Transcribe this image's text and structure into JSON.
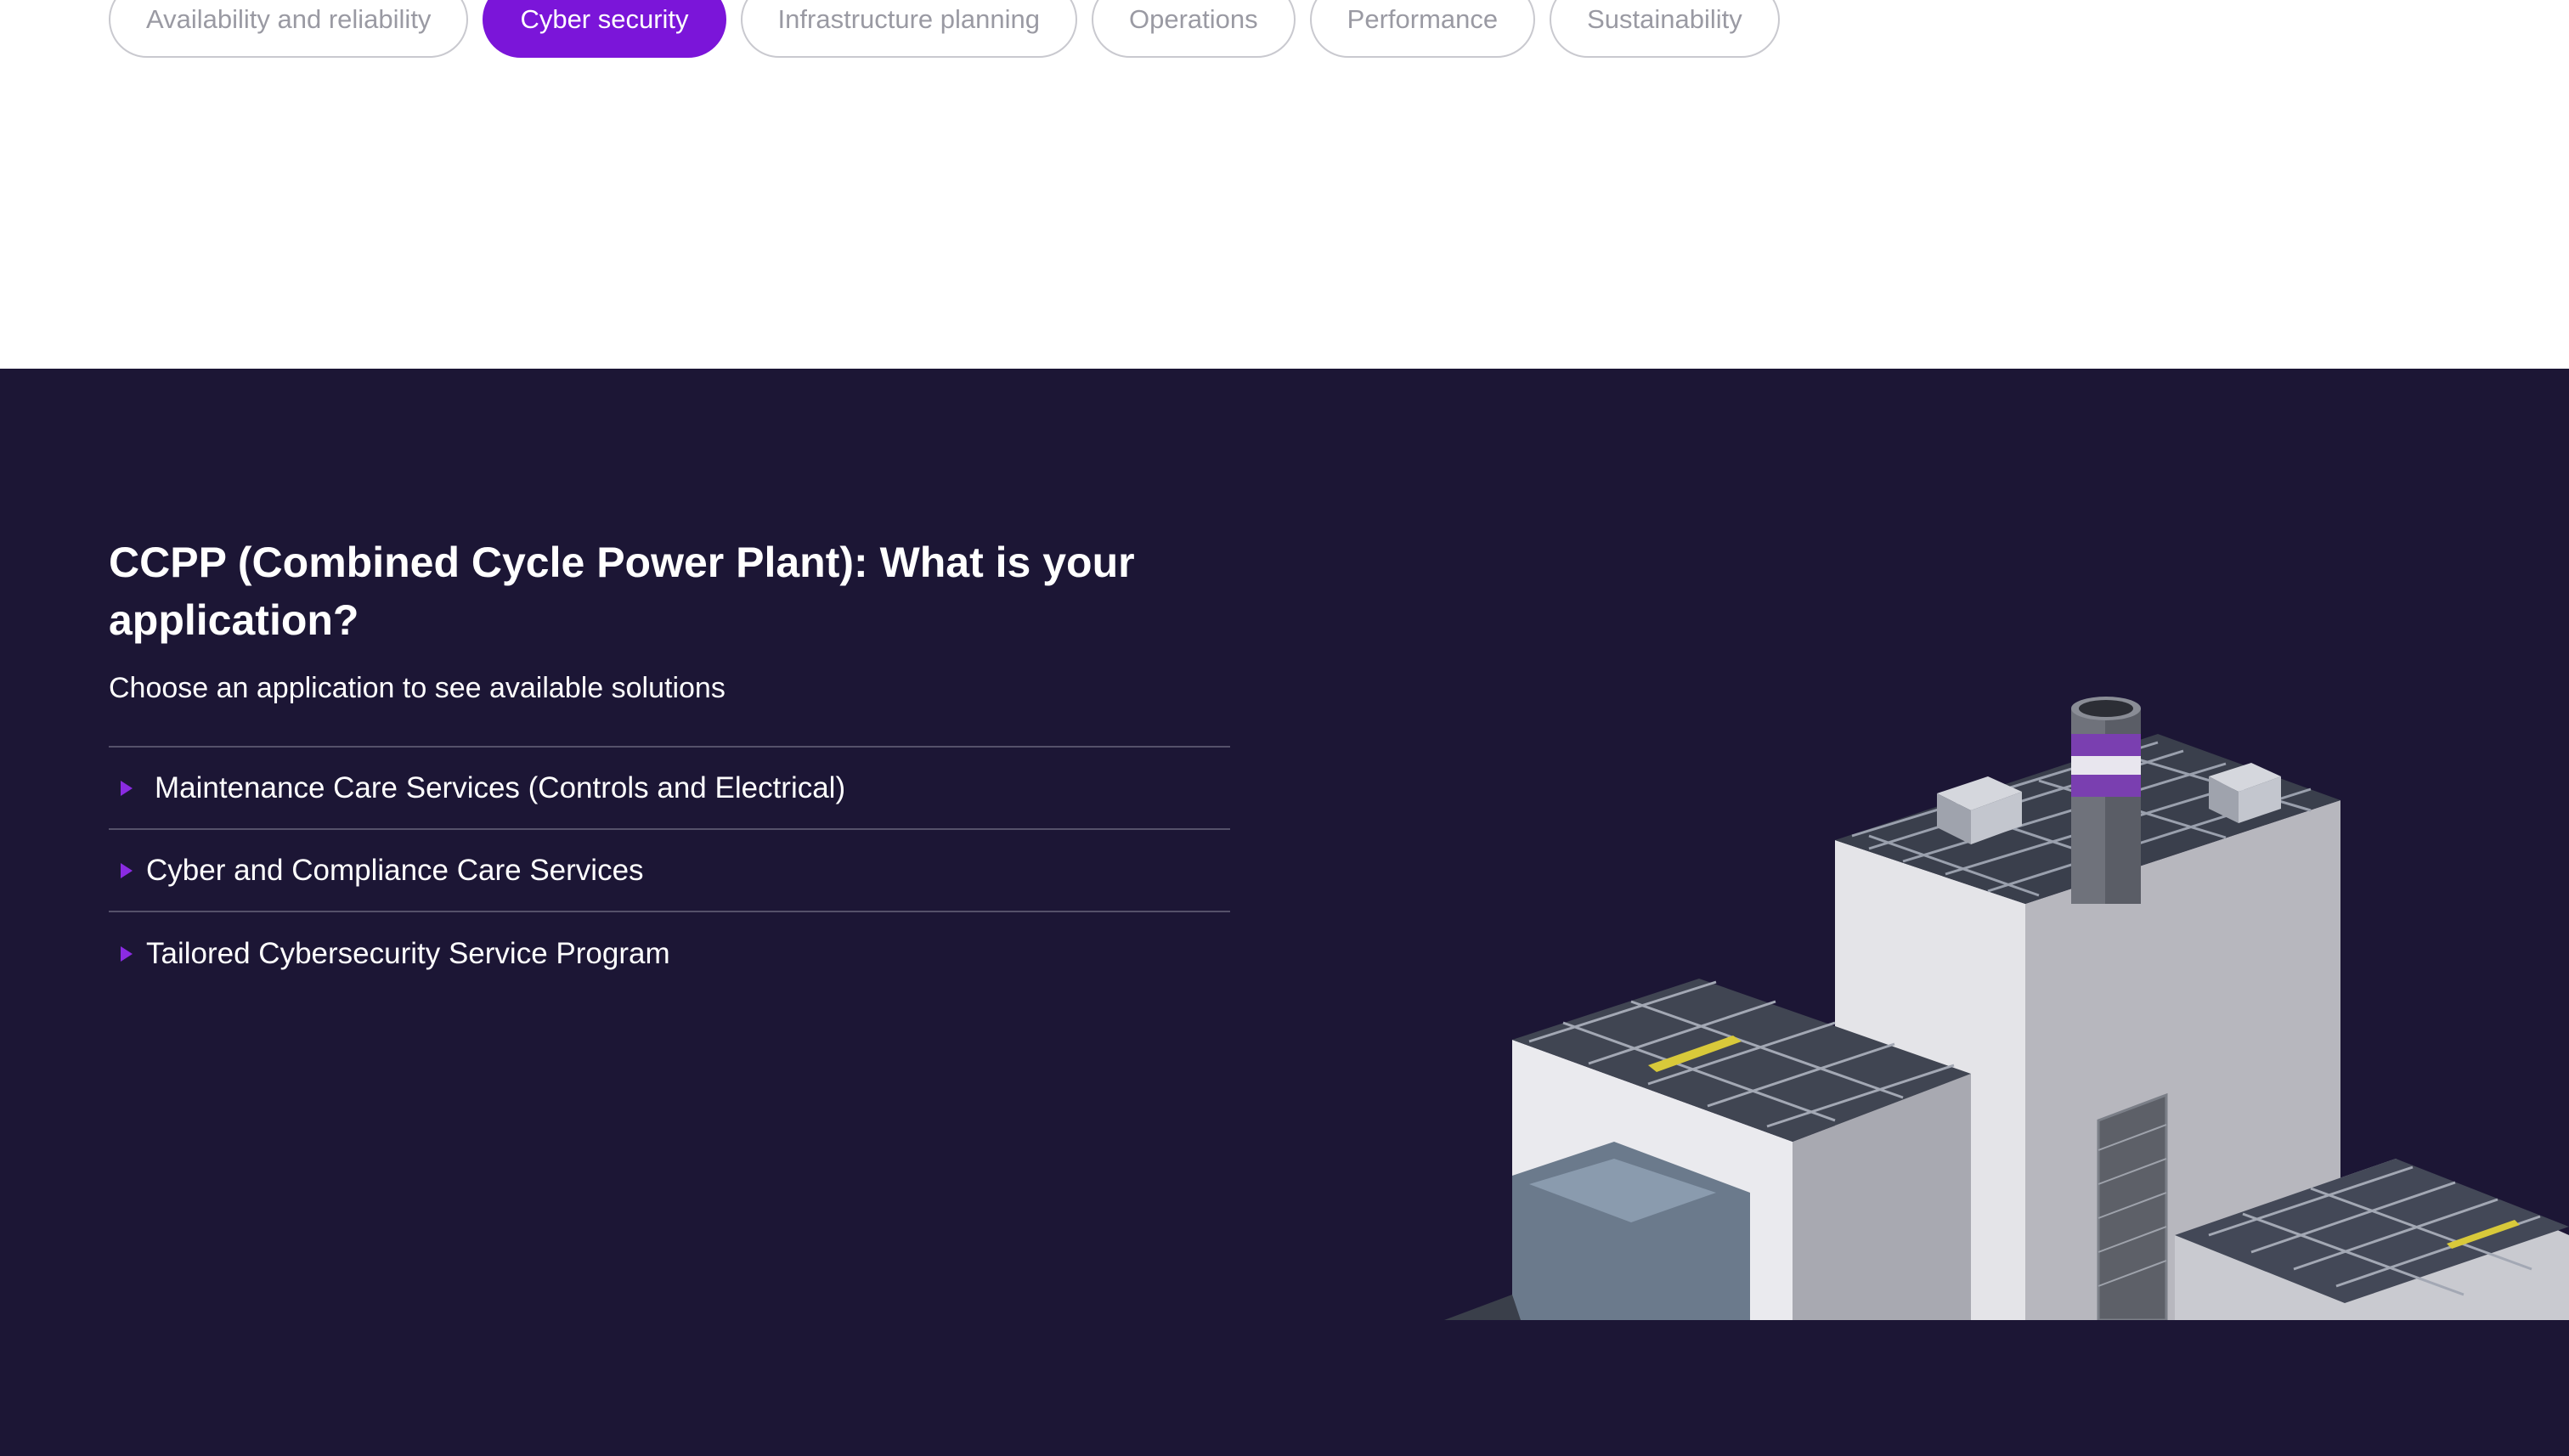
{
  "filters": {
    "chips": [
      {
        "label": "Availability and reliability",
        "active": false
      },
      {
        "label": "Cyber security",
        "active": true
      },
      {
        "label": "Infrastructure planning",
        "active": false
      },
      {
        "label": "Operations",
        "active": false
      },
      {
        "label": "Performance",
        "active": false
      },
      {
        "label": "Sustainability",
        "active": false
      }
    ]
  },
  "section": {
    "title": "CCPP (Combined Cycle Power Plant): What is your application?",
    "subtitle": "Choose an application to see available solutions",
    "applications": [
      {
        "label": "Maintenance Care Services (Controls and Electrical)"
      },
      {
        "label": "Cyber and Compliance Care Services"
      },
      {
        "label": "Tailored Cybersecurity Service Program"
      }
    ]
  },
  "illustration": {
    "icon": "power-plant-illustration"
  },
  "colors": {
    "accent": "#7b15d9",
    "dark_background": "#1c1635",
    "chip_border": "#c9c9cf",
    "chip_text": "#9a9aa3"
  }
}
